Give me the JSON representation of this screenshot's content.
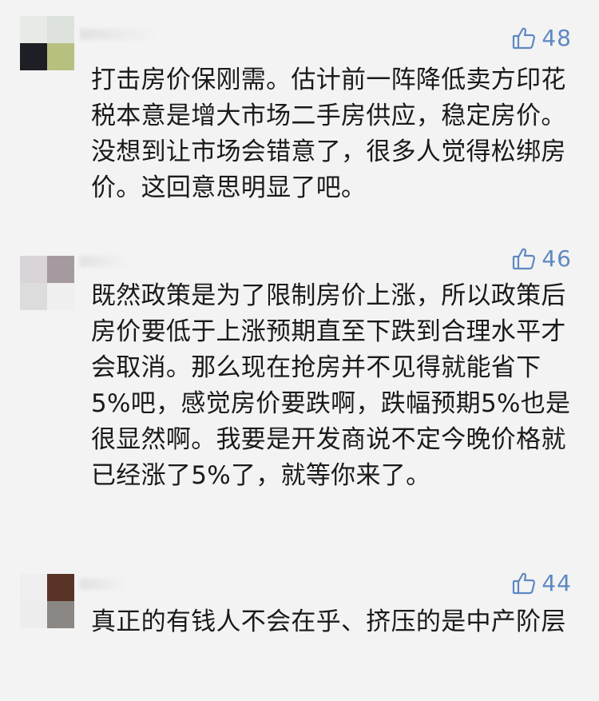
{
  "colors": {
    "background": "#f3f3f3",
    "text": "#1a1a1a",
    "like_accent": "#5d88c2"
  },
  "icons": {
    "like": "thumbs-up-icon"
  },
  "comments": [
    {
      "likes": "48",
      "text": "打击房价保刚需。估计前一阵降低卖方印花税本意是增大市场二手房供应，稳定房价。没想到让市场会错意了，很多人觉得松绑房价。这回意思明显了吧。"
    },
    {
      "likes": "46",
      "text": "既然政策是为了限制房价上涨，所以政策后房价要低于上涨预期直至下跌到合理水平才会取消。那么现在抢房并不见得就能省下5%吧，感觉房价要跌啊，跌幅预期5%也是很显然啊。我要是开发商说不定今晚价格就已经涨了5%了，就等你来了。"
    },
    {
      "likes": "44",
      "text": "真正的有钱人不会在乎、挤压的是中产阶层"
    }
  ]
}
